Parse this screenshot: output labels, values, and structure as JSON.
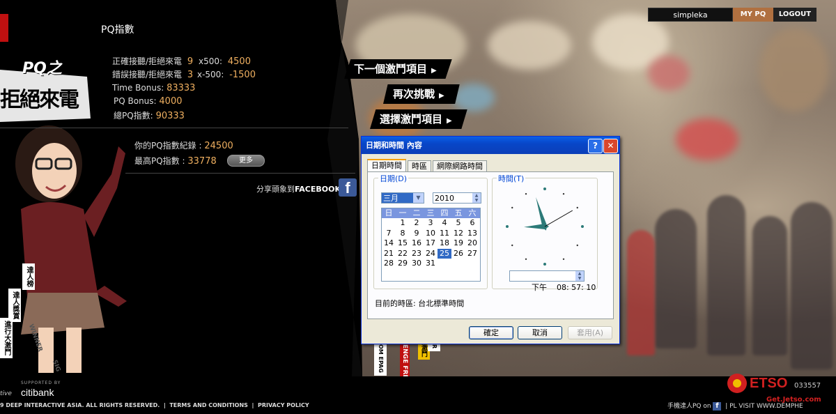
{
  "pq": {
    "title": "PQ指數",
    "rows": [
      {
        "label": "正確接聽/拒絕來電",
        "count": "9",
        "mult": "x500:",
        "value": "4500"
      },
      {
        "label": "錯誤接聽/拒絕來電",
        "count": "3",
        "mult": "x-500:",
        "value": "-1500"
      }
    ],
    "time_bonus_label": "Time Bonus:",
    "time_bonus": "83333",
    "pq_bonus_label": "PQ Bonus:",
    "pq_bonus": "4000",
    "total_label": "總PQ指數:",
    "total": "90333",
    "record_label": "你的PQ指數紀錄 :",
    "record": "24500",
    "best_label": "最高PQ指數 :",
    "best": "33778",
    "more_label": "更多",
    "share_label": "分享頭象到",
    "share_brand": "FACEBOOK"
  },
  "menu": {
    "next": "下一個激鬥項目",
    "retry": "再次挑戰",
    "select": "選擇激鬥項目"
  },
  "userbar": {
    "username": "simpleka",
    "mypq": "MY PQ",
    "logout": "LOGOUT"
  },
  "left": {
    "game_title": "PQ之",
    "game_sub": "拒絕來電",
    "tags": [
      "達人榜",
      "達人獎賞",
      "進行大激鬥"
    ],
    "extra_tags": [
      "WINNER",
      "SIG"
    ],
    "bottom_tags": [
      "OM EPAG",
      "ENGE FRE",
      "激鬥",
      "R"
    ]
  },
  "footer": {
    "supported_by": "SUPPORTED BY",
    "sponsor": "citibank",
    "active": "tive",
    "copyright": "9 DEEP INTERACTIVE ASIA. ALL RIGHTS RESERVED.",
    "terms": "TERMS AND CONDITIONS",
    "privacy": "PRIVACY POLICY",
    "bottom_right": "手機達人PQ on",
    "visit_label": "PL",
    "visit_url": "VISIT WWW.DEMPHE",
    "visits": "033557"
  },
  "dialog": {
    "title": "日期和時間 內容",
    "tabs": [
      "日期時間",
      "時區",
      "網際網路時間"
    ],
    "date_group": "日期(D)",
    "time_group": "時間(T)",
    "month": "三月",
    "year": "2010",
    "weekdays": [
      "日",
      "一",
      "二",
      "三",
      "四",
      "五",
      "六"
    ],
    "weeks": [
      [
        "",
        "1",
        "2",
        "3",
        "4",
        "5",
        "6"
      ],
      [
        "7",
        "8",
        "9",
        "10",
        "11",
        "12",
        "13"
      ],
      [
        "14",
        "15",
        "16",
        "17",
        "18",
        "19",
        "20"
      ],
      [
        "21",
        "22",
        "23",
        "24",
        "25",
        "26",
        "27"
      ],
      [
        "28",
        "29",
        "30",
        "31",
        "",
        "",
        ""
      ]
    ],
    "selected_day": "25",
    "time": "下午    08: 57: 10",
    "clock_hour": 8,
    "clock_minute": 57,
    "clock_second": 10,
    "timezone": "目前的時區: 台北標準時間",
    "ok": "確定",
    "cancel": "取消",
    "apply": "套用(A)"
  },
  "watermark": {
    "brand": "ETSO",
    "url": "Get.Jetso.com"
  },
  "colors": {
    "accent_orange": "#f0b060",
    "facebook": "#3b5998",
    "xp_title": "#0a5fe6",
    "calendar_head": "#7a96df"
  }
}
